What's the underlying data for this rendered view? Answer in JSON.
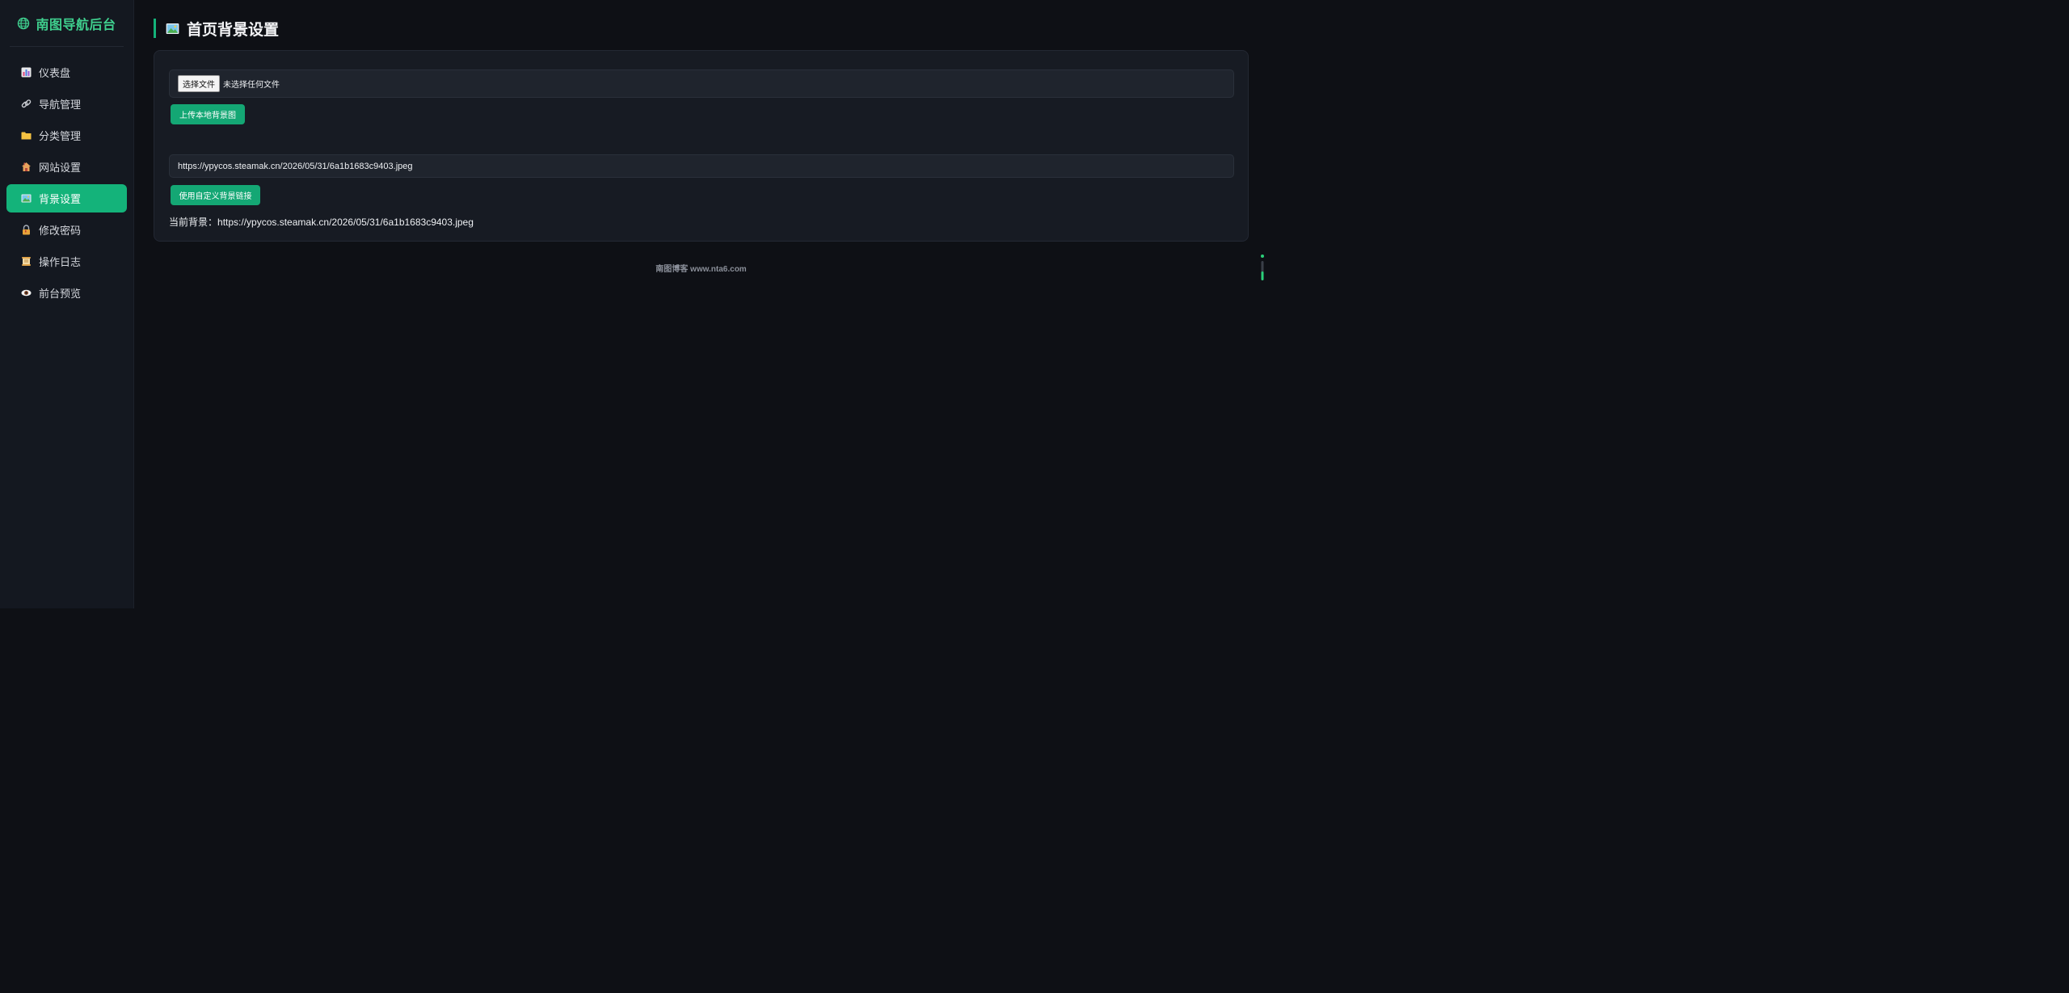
{
  "sidebar": {
    "brand_title": "南图导航后台",
    "brand_icon": "globe-icon",
    "accent": "#3fcf8e",
    "items": [
      {
        "label": "仪表盘",
        "icon": "bar-chart-icon",
        "active": false
      },
      {
        "label": "导航管理",
        "icon": "link-icon",
        "active": false
      },
      {
        "label": "分类管理",
        "icon": "folder-icon",
        "active": false
      },
      {
        "label": "网站设置",
        "icon": "house-icon",
        "active": false
      },
      {
        "label": "背景设置",
        "icon": "picture-icon",
        "active": true
      },
      {
        "label": "修改密码",
        "icon": "lock-icon",
        "active": false
      },
      {
        "label": "操作日志",
        "icon": "scroll-icon",
        "active": false
      },
      {
        "label": "前台预览",
        "icon": "eye-icon",
        "active": false
      }
    ]
  },
  "main": {
    "title": "首页背景设置",
    "title_icon": "picture-icon",
    "file_input": {
      "button_label": "选择文件",
      "status": "未选择任何文件"
    },
    "upload_button": "上传本地背景图",
    "url_input_value": "https://ypycos.steamak.cn/2026/05/31/6a1b1683c9403.jpeg",
    "custom_button": "使用自定义背景链接",
    "current_label": "当前背景：",
    "current_value": "https://ypycos.steamak.cn/2026/05/31/6a1b1683c9403.jpeg"
  },
  "footer": {
    "text": "南图博客 www.nta6.com"
  },
  "colors": {
    "primary": "#14b37a",
    "background": "#0e1015",
    "sidebar": "#141820",
    "card": "#171b23"
  }
}
